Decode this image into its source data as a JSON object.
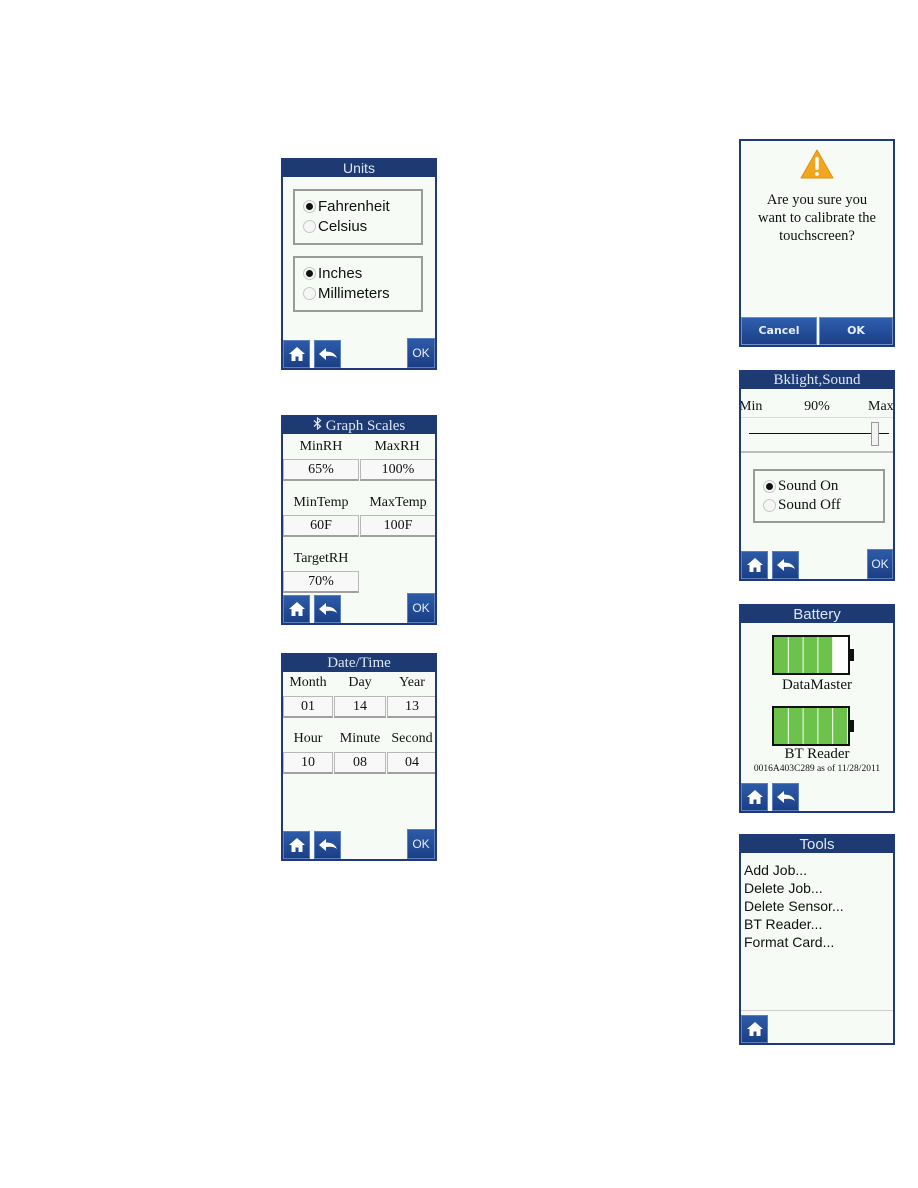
{
  "units": {
    "title": "Units",
    "temperature_options": [
      {
        "label": "Fahrenheit",
        "selected": true
      },
      {
        "label": "Celsius",
        "selected": false
      }
    ],
    "length_options": [
      {
        "label": "Inches",
        "selected": true
      },
      {
        "label": "Millimeters",
        "selected": false
      }
    ],
    "ok_label": "OK"
  },
  "graph_scales": {
    "title": "Graph Scales",
    "title_icon": "bluetooth-icon",
    "min_rh_label": "MinRH",
    "max_rh_label": "MaxRH",
    "min_rh_value": "65%",
    "max_rh_value": "100%",
    "min_temp_label": "MinTemp",
    "max_temp_label": "MaxTemp",
    "min_temp_value": "60F",
    "max_temp_value": "100F",
    "target_rh_label": "TargetRH",
    "target_rh_value": "70%",
    "ok_label": "OK"
  },
  "date_time": {
    "title": "Date/Time",
    "month_label": "Month",
    "day_label": "Day",
    "year_label": "Year",
    "month_value": "01",
    "day_value": "14",
    "year_value": "13",
    "hour_label": "Hour",
    "minute_label": "Minute",
    "second_label": "Second",
    "hour_value": "10",
    "minute_value": "08",
    "second_value": "04",
    "ok_label": "OK"
  },
  "calibrate_dialog": {
    "icon": "warning-icon",
    "message_line1": "Are you sure you",
    "message_line2": "want to calibrate the",
    "message_line3": "touchscreen?",
    "cancel_label": "Cancel",
    "ok_label": "OK"
  },
  "backlight_sound": {
    "title": "Bklight,Sound",
    "min_label": "Min",
    "max_label": "Max",
    "backlight_value": "90%",
    "backlight_fraction": 0.9,
    "sound_options": [
      {
        "label": "Sound On",
        "selected": true
      },
      {
        "label": "Sound Off",
        "selected": false
      }
    ],
    "ok_label": "OK"
  },
  "battery": {
    "title": "Battery",
    "devices": [
      {
        "name": "DataMaster",
        "level_fraction": 0.8,
        "segments_filled": 4,
        "segments_total": 5
      },
      {
        "name": "BT Reader",
        "level_fraction": 1.0,
        "segments_filled": 5,
        "segments_total": 5
      }
    ],
    "bt_reader_info": "0016A403C289 as of 11/28/2011",
    "fill_color": "#6cc24a"
  },
  "tools": {
    "title": "Tools",
    "items": [
      "Add Job...",
      "Delete Job...",
      "Delete Sensor...",
      "BT Reader...",
      "Format Card..."
    ]
  },
  "colors": {
    "titlebar": "#1d3a72",
    "button": "#22488f",
    "screen_bg": "#f6fbf6",
    "warning": "#f2a51f"
  }
}
